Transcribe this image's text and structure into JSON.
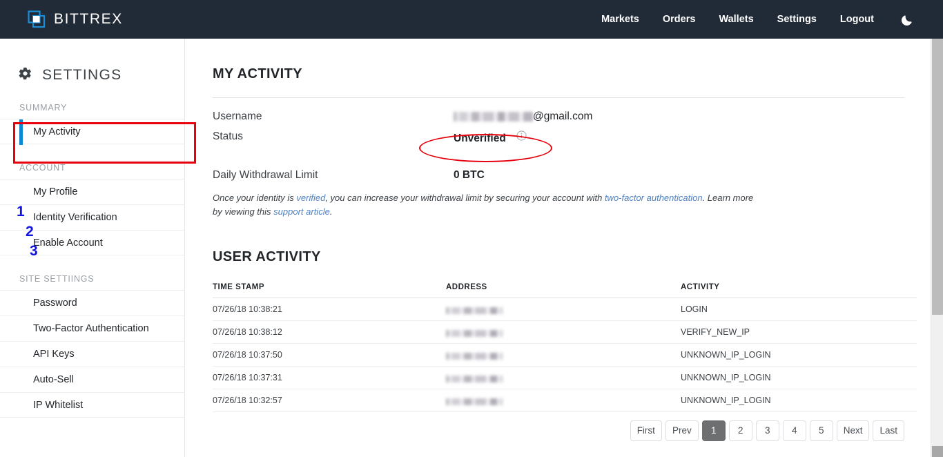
{
  "header": {
    "brand": "BITTREX",
    "brand_icon": "bittrex-logo-icon",
    "brand_color": "#1b8ed6",
    "bg_color": "#212a37",
    "nav": [
      {
        "label": "Markets"
      },
      {
        "label": "Orders"
      },
      {
        "label": "Wallets"
      },
      {
        "label": "Settings"
      },
      {
        "label": "Logout"
      }
    ],
    "theme_toggle_icon": "moon-icon"
  },
  "sidebar": {
    "icon": "gear-icon",
    "title": "SETTINGS",
    "groups": [
      {
        "label": "SUMMARY",
        "items": [
          {
            "label": "My Activity",
            "active": true
          }
        ]
      },
      {
        "label": "ACCOUNT",
        "items": [
          {
            "label": "My Profile",
            "active": false
          },
          {
            "label": "Identity Verification",
            "active": false
          },
          {
            "label": "Enable Account",
            "active": false
          }
        ]
      },
      {
        "label": "SITE SETTIINGS",
        "items": [
          {
            "label": "Password",
            "active": false
          },
          {
            "label": "Two-Factor Authentication",
            "active": false
          },
          {
            "label": "API Keys",
            "active": false
          },
          {
            "label": "Auto-Sell",
            "active": false
          },
          {
            "label": "IP Whitelist",
            "active": false
          }
        ]
      }
    ]
  },
  "main": {
    "page_title": "MY ACTIVITY",
    "username_label": "Username",
    "username_value_suffix": "@gmail.com",
    "username_redacted": true,
    "status_label": "Status",
    "status_value": "Unverified",
    "status_info_icon": "info-circle-icon",
    "limit_label": "Daily Withdrawal Limit",
    "limit_value": "0 BTC",
    "note": {
      "part1": "Once your identity is ",
      "link1": "verified",
      "part2": ", you can increase your withdrawal limit by securing your account with ",
      "link2": "two-factor authentication",
      "part3": ". Learn more by viewing this ",
      "link3": "support article",
      "part4": "."
    },
    "activity_title": "USER ACTIVITY",
    "table": {
      "columns": [
        "TIME STAMP",
        "ADDRESS",
        "ACTIVITY"
      ],
      "rows": [
        {
          "timestamp": "07/26/18 10:38:21",
          "address": "",
          "address_redacted": true,
          "activity": "LOGIN"
        },
        {
          "timestamp": "07/26/18 10:38:12",
          "address": "",
          "address_redacted": true,
          "activity": "VERIFY_NEW_IP"
        },
        {
          "timestamp": "07/26/18 10:37:50",
          "address": "",
          "address_redacted": true,
          "activity": "UNKNOWN_IP_LOGIN"
        },
        {
          "timestamp": "07/26/18 10:37:31",
          "address": "",
          "address_redacted": true,
          "activity": "UNKNOWN_IP_LOGIN"
        },
        {
          "timestamp": "07/26/18 10:32:57",
          "address": "",
          "address_redacted": true,
          "activity": "UNKNOWN_IP_LOGIN"
        }
      ]
    },
    "pagination": {
      "first": "First",
      "prev": "Prev",
      "pages": [
        "1",
        "2",
        "3",
        "4",
        "5"
      ],
      "current": "1",
      "next": "Next",
      "last": "Last"
    }
  },
  "annotations": {
    "color_rect": "#e8000d",
    "color_number": "#1414e0",
    "numbers": [
      "1",
      "2",
      "3"
    ]
  }
}
